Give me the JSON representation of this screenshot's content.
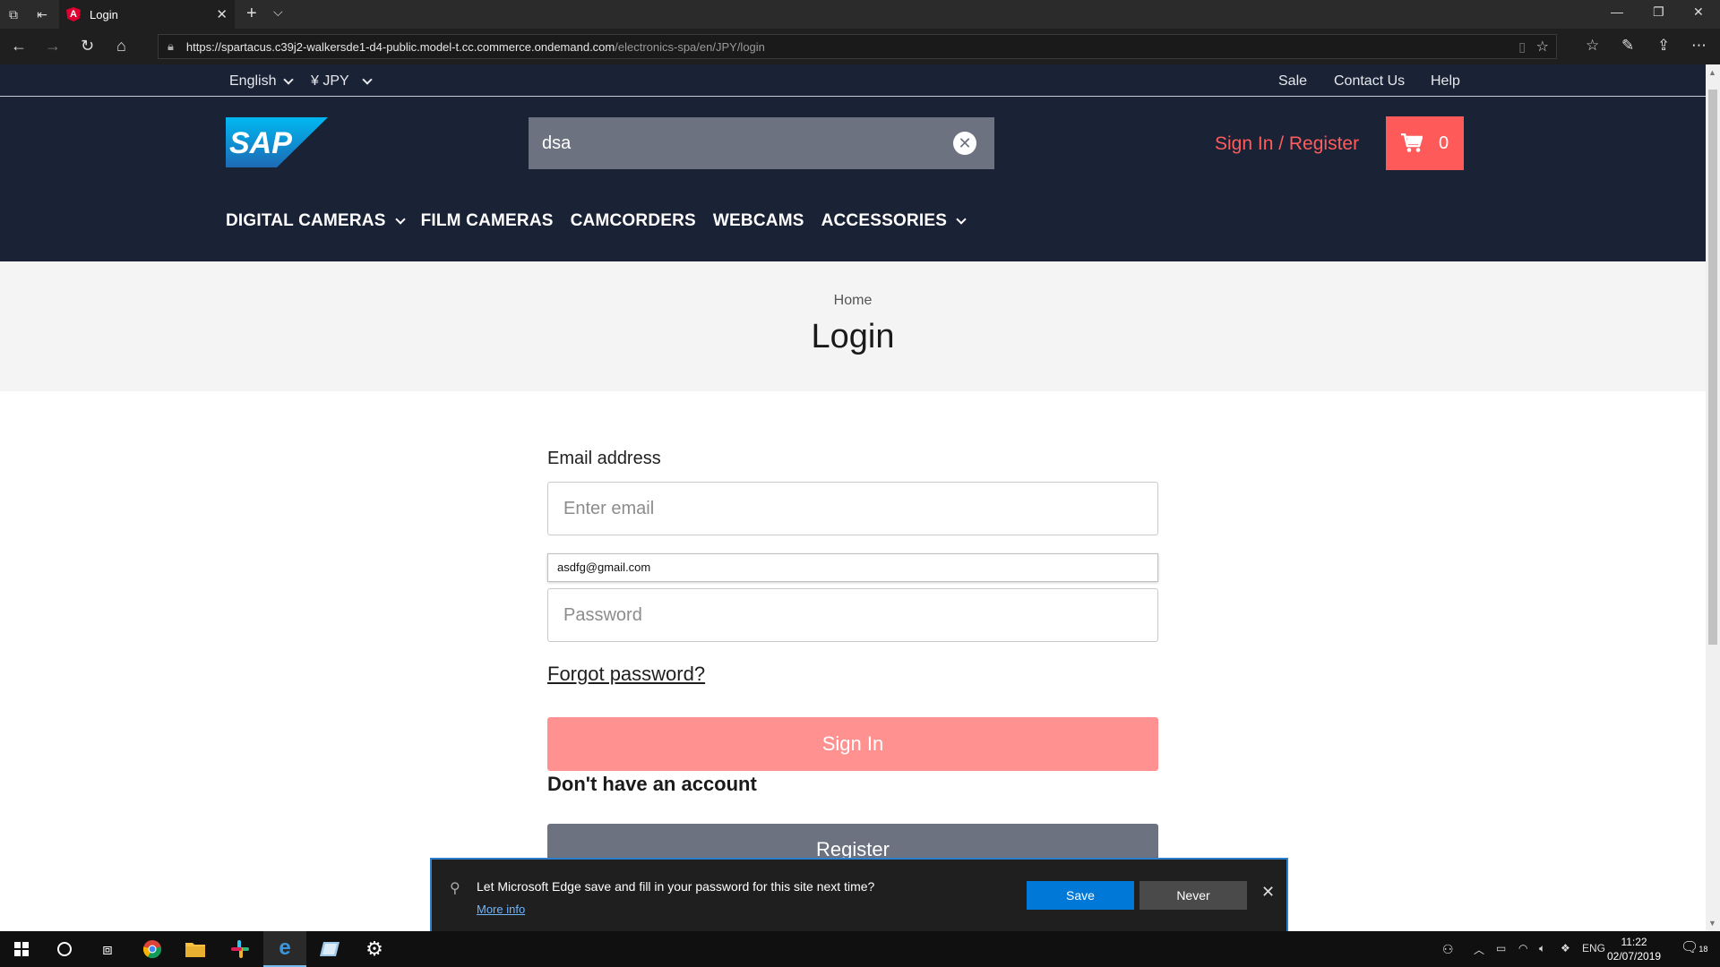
{
  "browser": {
    "tab_title": "Login",
    "tab_favicon": "A",
    "url_host": "https://spartacus.c39j2-walkersde1-d4-public.model-t.cc.commerce.ondemand.com",
    "url_path": "/electronics-spa/en/JPY/login"
  },
  "topbar": {
    "language": "English",
    "currency": "¥ JPY",
    "links": [
      "Sale",
      "Contact Us",
      "Help"
    ]
  },
  "header": {
    "search_value": "dsa",
    "signin_label": "Sign In / Register",
    "cart_count": "0",
    "categories": [
      "DIGITAL CAMERAS",
      "FILM CAMERAS",
      "CAMCORDERS",
      "WEBCAMS",
      "ACCESSORIES"
    ]
  },
  "page": {
    "breadcrumb": "Home",
    "title": "Login"
  },
  "form": {
    "email_label": "Email address",
    "email_placeholder": "Enter email",
    "autofill_suggestion": "asdfg@gmail.com",
    "password_placeholder": "Password",
    "forgot_label": "Forgot password?",
    "signin_button": "Sign In",
    "no_account": "Don't have an account",
    "register_button": "Register"
  },
  "password_prompt": {
    "message": "Let Microsoft Edge save and fill in your password for this site next time?",
    "more_info": "More info",
    "save": "Save",
    "never": "Never"
  },
  "taskbar": {
    "language": "ENG",
    "time": "11:22",
    "date": "02/07/2019",
    "notifications": "18"
  },
  "colors": {
    "site_header": "#1a2236",
    "accent": "#ff5a5a",
    "signin_button": "#ff9290",
    "edge_save": "#0078d7"
  }
}
